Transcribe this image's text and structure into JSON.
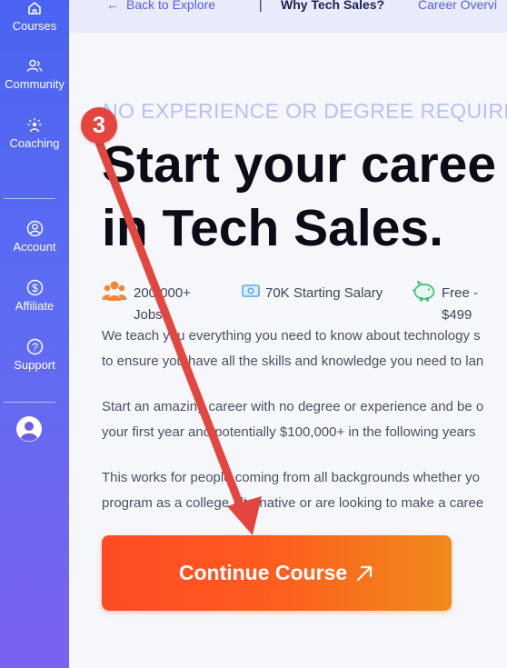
{
  "sidebar": {
    "items": [
      {
        "label": "Courses",
        "icon": "home-icon"
      },
      {
        "label": "Community",
        "icon": "community-icon"
      },
      {
        "label": "Coaching",
        "icon": "coaching-icon"
      },
      {
        "label": "Account",
        "icon": "account-icon"
      },
      {
        "label": "Affiliate",
        "icon": "dollar-icon"
      },
      {
        "label": "Support",
        "icon": "help-icon"
      }
    ],
    "avatar_icon": "avatar-icon"
  },
  "topbar": {
    "back_label": "Back to Explore",
    "separator": "|",
    "tabs": [
      "Why Tech Sales?",
      "Career Overvi"
    ]
  },
  "hero": {
    "eyebrow": "NO EXPERIENCE OR DEGREE REQUIRE",
    "headline_line1": "Start your caree",
    "headline_line2": "in Tech Sales."
  },
  "stats": [
    {
      "line1": "200,000+",
      "line2": "Jobs",
      "icon": "people-icon"
    },
    {
      "line1": "70K Starting Salary",
      "line2": "",
      "icon": "money-icon"
    },
    {
      "line1": "Free -",
      "line2": "$499",
      "icon": "piggy-bank-icon"
    }
  ],
  "paragraphs": [
    [
      "We teach you everything you need to know about technology s",
      "to ensure you have all the skills and knowledge you need to lan"
    ],
    [
      "Start an amazing career with no degree or experience and be o",
      "your first year and potentially $100,000+ in the following years"
    ],
    [
      "This works for people coming from all backgrounds whether yo",
      "program as a college alternative or are looking to make a caree"
    ]
  ],
  "cta": {
    "label": "Continue Course"
  },
  "annotation": {
    "step": "3"
  },
  "colors": {
    "sidebar_top": "#4a63f2",
    "sidebar_bottom": "#7a62f0",
    "accent": "#5361d8",
    "cta_start": "#ff4b24",
    "cta_end": "#f08a1c",
    "annotation": "#e2463f",
    "stat_icon_orange": "#f0883a",
    "stat_icon_blue": "#5aa8e8",
    "stat_icon_green": "#3fbf72"
  }
}
